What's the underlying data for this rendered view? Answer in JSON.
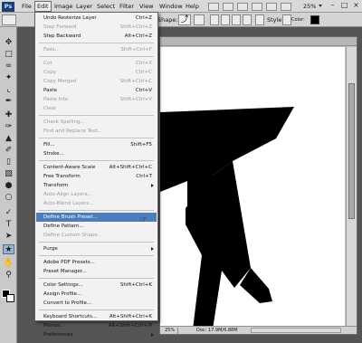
{
  "app": {
    "logo": "Ps"
  },
  "menubar": {
    "items": [
      "File",
      "Edit",
      "Image",
      "Layer",
      "Select",
      "Filter",
      "View",
      "Window",
      "Help"
    ],
    "zoom": "25%"
  },
  "options": {
    "shape_label": "Shape:",
    "style_label": "Style:",
    "color_label": "Color:"
  },
  "edit_menu": {
    "items": [
      {
        "label": "Undo Resterize Layer",
        "shortcut": "Ctrl+Z",
        "state": "normal"
      },
      {
        "label": "Step Forward",
        "shortcut": "Shift+Ctrl+Z",
        "state": "disabled"
      },
      {
        "label": "Step Backward",
        "shortcut": "Alt+Ctrl+Z",
        "state": "normal"
      },
      {
        "sep": true
      },
      {
        "label": "Fade...",
        "shortcut": "Shift+Ctrl+F",
        "state": "disabled"
      },
      {
        "sep": true
      },
      {
        "label": "Cut",
        "shortcut": "Ctrl+X",
        "state": "disabled"
      },
      {
        "label": "Copy",
        "shortcut": "Ctrl+C",
        "state": "disabled"
      },
      {
        "label": "Copy Merged",
        "shortcut": "Shift+Ctrl+C",
        "state": "disabled"
      },
      {
        "label": "Paste",
        "shortcut": "Ctrl+V",
        "state": "normal"
      },
      {
        "label": "Paste Into",
        "shortcut": "Shift+Ctrl+V",
        "state": "disabled"
      },
      {
        "label": "Clear",
        "shortcut": "",
        "state": "disabled"
      },
      {
        "sep": true
      },
      {
        "label": "Check Spelling...",
        "shortcut": "",
        "state": "disabled"
      },
      {
        "label": "Find and Replace Text...",
        "shortcut": "",
        "state": "disabled"
      },
      {
        "sep": true
      },
      {
        "label": "Fill...",
        "shortcut": "Shift+F5",
        "state": "normal"
      },
      {
        "label": "Stroke...",
        "shortcut": "",
        "state": "normal"
      },
      {
        "sep": true
      },
      {
        "label": "Content-Aware Scale",
        "shortcut": "Alt+Shift+Ctrl+C",
        "state": "normal"
      },
      {
        "label": "Free Transform",
        "shortcut": "Ctrl+T",
        "state": "normal"
      },
      {
        "label": "Transform",
        "shortcut": "",
        "state": "normal",
        "submenu": true
      },
      {
        "label": "Auto-Align Layers...",
        "shortcut": "",
        "state": "disabled"
      },
      {
        "label": "Auto-Blend Layers...",
        "shortcut": "",
        "state": "disabled"
      },
      {
        "sep": true
      },
      {
        "label": "Define Brush Preset...",
        "shortcut": "",
        "state": "highlight"
      },
      {
        "label": "Define Pattern...",
        "shortcut": "",
        "state": "normal"
      },
      {
        "label": "Define Custom Shape...",
        "shortcut": "",
        "state": "disabled"
      },
      {
        "sep": true
      },
      {
        "label": "Purge",
        "shortcut": "",
        "state": "normal",
        "submenu": true
      },
      {
        "sep": true
      },
      {
        "label": "Adobe PDF Presets...",
        "shortcut": "",
        "state": "normal"
      },
      {
        "label": "Preset Manager...",
        "shortcut": "",
        "state": "normal"
      },
      {
        "sep": true
      },
      {
        "label": "Color Settings...",
        "shortcut": "Shift+Ctrl+K",
        "state": "normal"
      },
      {
        "label": "Assign Profile...",
        "shortcut": "",
        "state": "normal"
      },
      {
        "label": "Convert to Profile...",
        "shortcut": "",
        "state": "normal"
      },
      {
        "sep": true
      },
      {
        "label": "Keyboard Shortcuts...",
        "shortcut": "Alt+Shift+Ctrl+K",
        "state": "normal"
      },
      {
        "label": "Menus...",
        "shortcut": "Alt+Shift+Ctrl+M",
        "state": "normal"
      },
      {
        "label": "Preferences",
        "shortcut": "",
        "state": "normal",
        "submenu": true
      }
    ]
  },
  "status": {
    "zoom": "25%",
    "doc": "Doc: 17.9M/6.88M"
  },
  "colors": {
    "highlight": "#4e7dbd",
    "menu_bg": "#f2f2f2",
    "shape_fill": "#000000"
  },
  "toolbox": {
    "tools": [
      "move-tool-icon",
      "marquee-tool-icon",
      "lasso-tool-icon",
      "magic-wand-icon",
      "crop-tool-icon",
      "eyedropper-icon",
      "healing-brush-icon",
      "brush-tool-icon",
      "clone-stamp-icon",
      "history-brush-icon",
      "eraser-icon",
      "gradient-icon",
      "blur-icon",
      "dodge-icon",
      "pen-tool-icon",
      "type-tool-icon",
      "path-select-icon",
      "custom-shape-icon",
      "hand-tool-icon",
      "zoom-tool-icon"
    ]
  }
}
